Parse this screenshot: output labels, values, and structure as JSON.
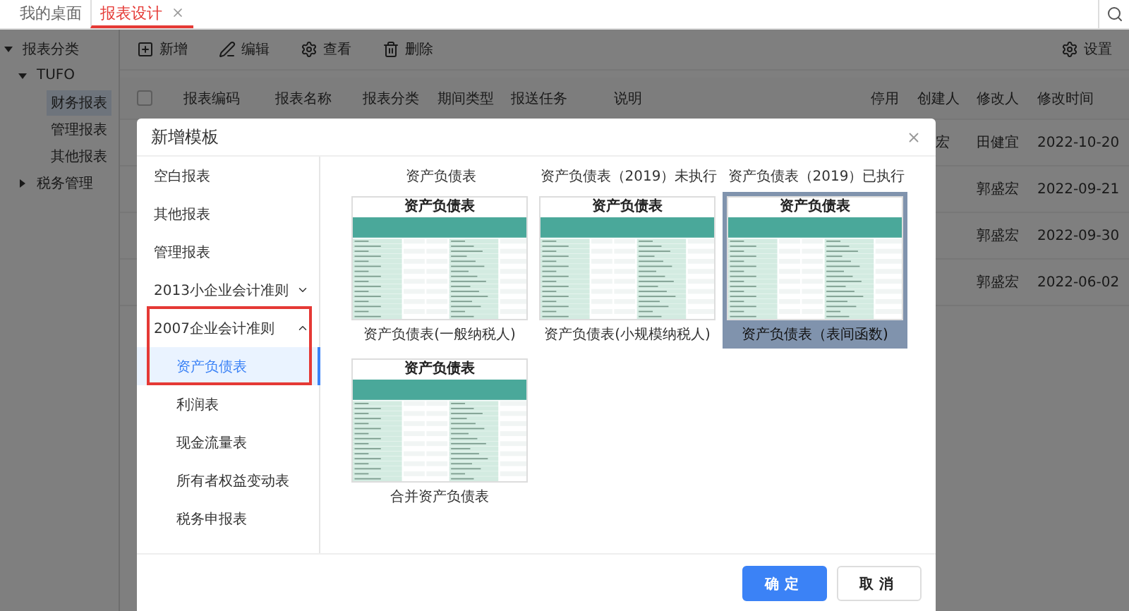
{
  "top_tabs": [
    {
      "label": "我的桌面",
      "selected": false,
      "closable": false
    },
    {
      "label": "报表设计",
      "selected": true,
      "closable": true
    }
  ],
  "sidebar": {
    "tree": [
      {
        "label": "报表分类",
        "selected": false,
        "expanded": true,
        "children": [
          {
            "label": "TUFO",
            "selected": false,
            "expanded": true,
            "children": [
              {
                "label": "财务报表",
                "selected": true
              },
              {
                "label": "管理报表",
                "selected": false
              },
              {
                "label": "其他报表",
                "selected": false
              }
            ]
          },
          {
            "label": "税务管理",
            "selected": false,
            "expanded": false
          }
        ]
      }
    ]
  },
  "toolbar": {
    "actions": [
      {
        "kind": "add",
        "label": "新增"
      },
      {
        "kind": "edit",
        "label": "编辑"
      },
      {
        "kind": "view",
        "label": "查看"
      },
      {
        "kind": "delete",
        "label": "删除"
      }
    ],
    "settings": "设置"
  },
  "table": {
    "header_checked": false,
    "columns": [
      "报表编码",
      "报表名称",
      "报表分类",
      "期间类型",
      "报送任务",
      "说明",
      "停用",
      "创建人",
      "修改人",
      "修改时间"
    ],
    "rows": [
      {
        "creator": "宏",
        "modifier": "田健宜",
        "modified": "2022-10-20"
      },
      {
        "modifier": "郭盛宏",
        "modified": "2022-09-21"
      },
      {
        "modifier": "郭盛宏",
        "modified": "2022-09-30"
      },
      {
        "modifier": "郭盛宏",
        "modified": "2022-06-02"
      }
    ]
  },
  "dialog": {
    "title": "新增模板",
    "menu": [
      {
        "kind": "item",
        "label": "空白报表"
      },
      {
        "kind": "item",
        "label": "其他报表"
      },
      {
        "kind": "item",
        "label": "管理报表"
      },
      {
        "kind": "group",
        "label": "2013小企业会计准则",
        "expanded": false
      },
      {
        "kind": "group",
        "label": "2007企业会计准则",
        "expanded": true,
        "children": [
          {
            "label": "资产负债表",
            "selected": true
          },
          {
            "label": "利润表",
            "selected": false
          },
          {
            "label": "现金流量表",
            "selected": false
          },
          {
            "label": "所有者权益变动表",
            "selected": false
          },
          {
            "label": "税务申报表",
            "selected": false
          }
        ]
      }
    ],
    "scrolled_captions": [
      "资产负债表",
      "资产负债表（2019）未执行",
      "资产负债表（2019）已执行"
    ],
    "cards": [
      {
        "preview_title": "资产负债表",
        "caption": "资产负债表(一般纳税人)",
        "selected": false
      },
      {
        "preview_title": "资产负债表",
        "caption": "资产负债表(小规模纳税人)",
        "selected": false
      },
      {
        "preview_title": "资产负债表",
        "caption": "资产负债表（表间函数)",
        "selected": true
      },
      {
        "preview_title": "资产负债表",
        "caption": "合并资产负债表",
        "selected": false
      }
    ],
    "buttons": [
      {
        "kind": "primary",
        "label": "确定"
      },
      {
        "kind": "default",
        "label": "取消"
      }
    ]
  }
}
